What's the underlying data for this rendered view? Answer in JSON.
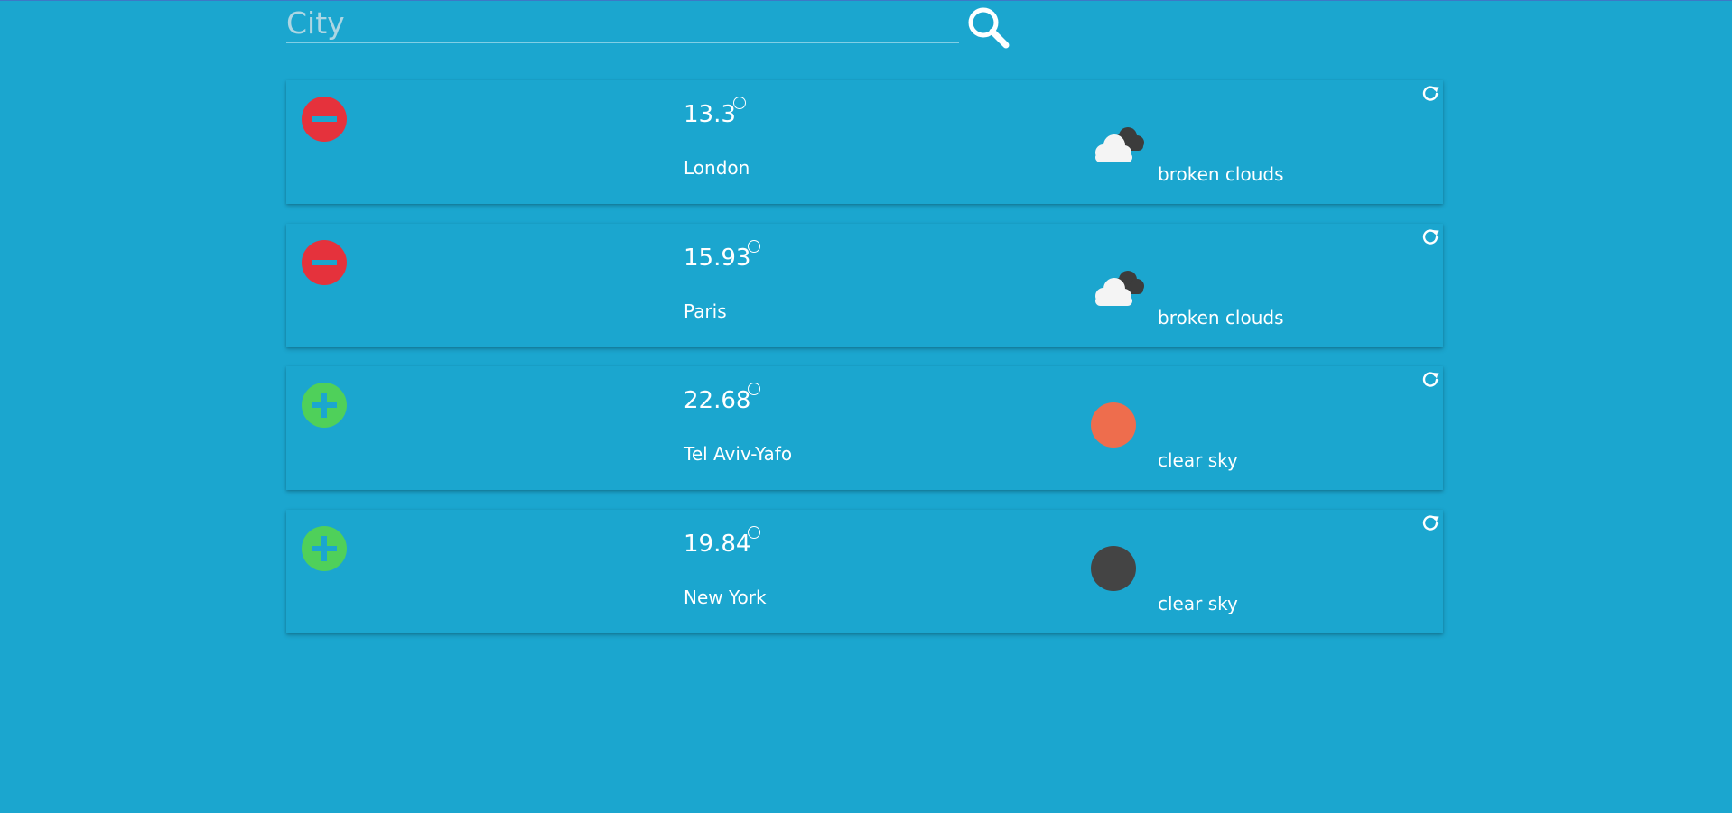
{
  "search": {
    "placeholder": "City",
    "value": "",
    "button_icon": "search-icon"
  },
  "colors": {
    "background": "#1ba6cf",
    "remove_button": "#e5323c",
    "add_button": "#4fd05a",
    "sun_day": "#ee6d4d",
    "sun_night": "#444444"
  },
  "cards": [
    {
      "temperature": "13.3",
      "city": "London",
      "description": "broken clouds",
      "weather_icon": "broken-clouds-icon",
      "favorite_action": "remove"
    },
    {
      "temperature": "15.93",
      "city": "Paris",
      "description": "broken clouds",
      "weather_icon": "broken-clouds-icon",
      "favorite_action": "remove"
    },
    {
      "temperature": "22.68",
      "city": "Tel Aviv-Yafo",
      "description": "clear sky",
      "weather_icon": "clear-sky-day-icon",
      "favorite_action": "add"
    },
    {
      "temperature": "19.84",
      "city": "New York",
      "description": "clear sky",
      "weather_icon": "clear-sky-night-icon",
      "favorite_action": "add"
    }
  ]
}
